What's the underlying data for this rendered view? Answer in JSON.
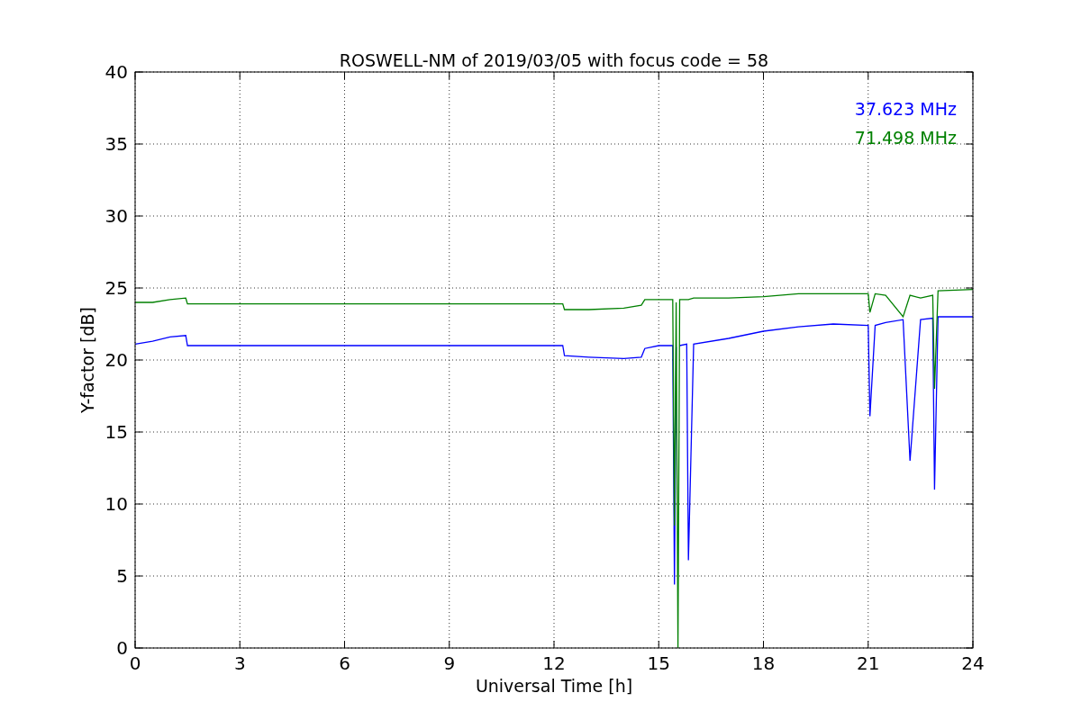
{
  "chart_data": {
    "type": "line",
    "title": "ROSWELL-NM of 2019/03/05 with focus code = 58",
    "xlabel": "Universal Time [h]",
    "ylabel": "Y-factor [dB]",
    "x": [
      0,
      0.5,
      1,
      1.45,
      1.5,
      3,
      6,
      9,
      12,
      12.25,
      12.3,
      13,
      14,
      14.5,
      14.6,
      15,
      15.4,
      15.45,
      15.5,
      15.55,
      15.6,
      15.8,
      15.85,
      16,
      17,
      18,
      19,
      20,
      21,
      21.05,
      21.2,
      21.5,
      22,
      22.2,
      22.5,
      22.85,
      22.9,
      23,
      24
    ],
    "series": [
      {
        "name": "37.623 MHz",
        "color": "#0000ff",
        "values": [
          21.1,
          21.3,
          21.6,
          21.7,
          21.0,
          21.0,
          21.0,
          21.0,
          21.0,
          21.0,
          20.3,
          20.2,
          20.1,
          20.2,
          20.8,
          21.0,
          21.0,
          4.4,
          20.9,
          null,
          21.0,
          21.1,
          6.1,
          21.1,
          21.5,
          22.0,
          22.3,
          22.5,
          22.4,
          16.1,
          22.4,
          22.6,
          22.8,
          13.0,
          22.8,
          22.9,
          11.0,
          23.0,
          23.0
        ]
      },
      {
        "name": "71.498 MHz",
        "color": "#008000",
        "values": [
          24.0,
          24.0,
          24.2,
          24.3,
          23.9,
          23.9,
          23.9,
          23.9,
          23.9,
          23.9,
          23.5,
          23.5,
          23.6,
          23.8,
          24.2,
          24.2,
          24.2,
          8.5,
          24.0,
          0.0,
          24.2,
          24.2,
          24.2,
          24.3,
          24.3,
          24.4,
          24.6,
          24.6,
          24.6,
          23.3,
          24.6,
          24.5,
          23.0,
          24.5,
          24.3,
          24.5,
          18.0,
          24.8,
          24.9
        ]
      }
    ],
    "xlim": [
      0,
      24
    ],
    "ylim": [
      0,
      40
    ],
    "xticks": [
      0,
      3,
      6,
      9,
      12,
      15,
      18,
      21,
      24
    ],
    "yticks": [
      0,
      5,
      10,
      15,
      20,
      25,
      30,
      35,
      40
    ],
    "grid": true
  }
}
